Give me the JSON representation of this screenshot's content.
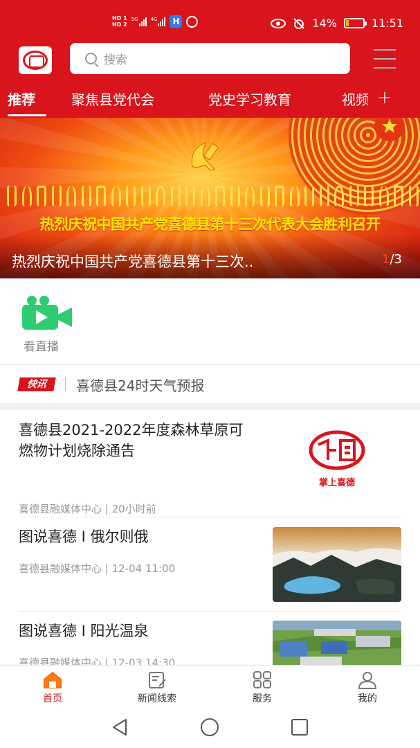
{
  "status_bar": {
    "hd_top": "HD 1",
    "hd_bottom": "HD 2",
    "sig1_label": "5G",
    "sig2_label": "4G",
    "battery": "14%",
    "battery_level": 0.14,
    "time": "11:51"
  },
  "header": {
    "search_placeholder": "搜索"
  },
  "tabs": [
    "推荐",
    "聚焦县党代会",
    "党史学习教育",
    "视频"
  ],
  "banner": {
    "slogan": "热烈庆祝中国共产党喜德县第十三次代表大会胜利召开",
    "caption": "热烈庆祝中国共产党喜德县第十三次..",
    "current": "1",
    "total": "/3"
  },
  "live": {
    "label": "看直播"
  },
  "flash": {
    "tag": "快讯",
    "text": "喜德县24时天气预报"
  },
  "news": [
    {
      "title": "喜德县2021-2022年度森林草原可燃物计划烧除通告",
      "meta": "喜德县融媒体中心 | 20小时前",
      "thumb_caption": "掌上喜德"
    },
    {
      "title": "图说喜德 I 俄尔则俄",
      "meta": "喜德县融媒体中心 | 12-04 11:00"
    },
    {
      "title": "图说喜德 I 阳光温泉",
      "meta": "喜德县融媒体中心 | 12-03 14:30"
    }
  ],
  "bottom_nav": {
    "items": [
      {
        "label": "首页",
        "icon": "home-icon"
      },
      {
        "label": "新闻线索",
        "icon": "news-clue-icon"
      },
      {
        "label": "服务",
        "icon": "services-grid-icon"
      },
      {
        "label": "我的",
        "icon": "profile-icon"
      }
    ],
    "active": 0
  },
  "colors": {
    "brand_red": "#d9141c",
    "live_green": "#2ecc71"
  }
}
